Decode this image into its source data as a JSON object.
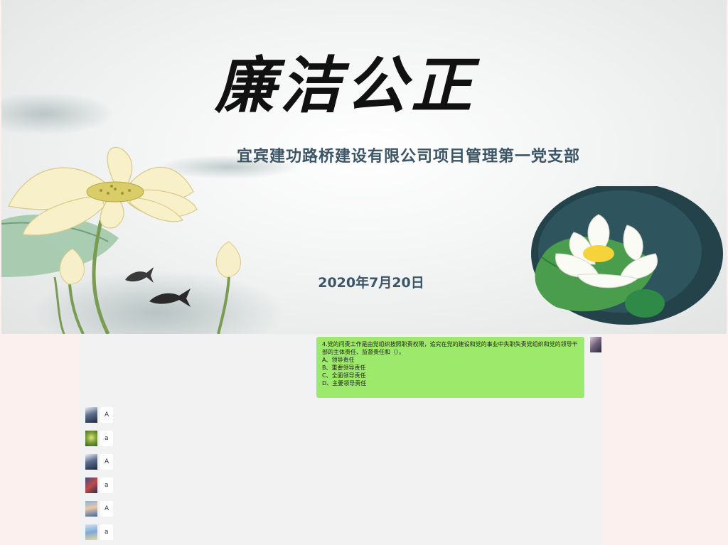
{
  "slide": {
    "title": "廉洁公正",
    "organization": "宜宾建功路桥建设有限公司项目管理第一党支部",
    "date": "2020年7月20日"
  },
  "chat": {
    "question_message": {
      "question": "4.党的问责工作是由党组织按照职责权限，追究在党的建设和党的事业中失职失责党组织和党的领导干部的主体责任、监督责任和（）。",
      "options": [
        "A、领导责任",
        "B、重要领导责任",
        "C、全面领导责任",
        "D、主要领导责任"
      ]
    },
    "replies": [
      {
        "text": "A",
        "avatar": "avatar-1"
      },
      {
        "text": "a",
        "avatar": "avatar-2"
      },
      {
        "text": "A",
        "avatar": "avatar-3"
      },
      {
        "text": "a",
        "avatar": "avatar-4"
      },
      {
        "text": "A",
        "avatar": "avatar-5"
      },
      {
        "text": "a",
        "avatar": "avatar-6"
      }
    ]
  },
  "colors": {
    "page_background": "#fcf0ef",
    "chat_background": "#f2f2f2",
    "outgoing_bubble": "#9de96c",
    "incoming_bubble": "#ffffff",
    "title_ink": "#111111",
    "subtitle_text": "#3b5566"
  }
}
